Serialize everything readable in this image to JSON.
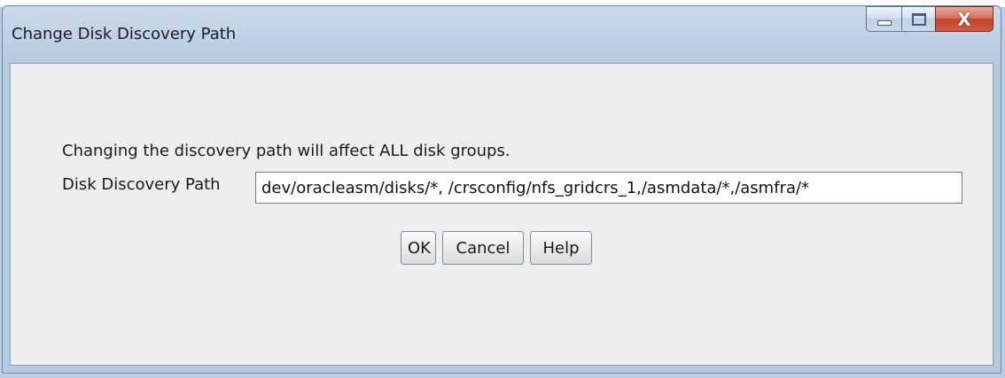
{
  "window": {
    "title": "Change Disk Discovery Path",
    "controls": {
      "minimize_icon": "minimize-icon",
      "maximize_icon": "maximize-icon",
      "close_glyph": "X"
    }
  },
  "content": {
    "message": "Changing the discovery path will affect ALL disk groups.",
    "path_label": "Disk Discovery Path",
    "path_value": "dev/oracleasm/disks/*, /crsconfig/nfs_gridcrs_1,/asmdata/*,/asmfra/*"
  },
  "buttons": {
    "ok": "OK",
    "cancel": "Cancel",
    "help": "Help"
  },
  "colors": {
    "title_bar": "#b7cbe0",
    "client_bg": "#eeeeee",
    "close_button": "#c4442a"
  }
}
